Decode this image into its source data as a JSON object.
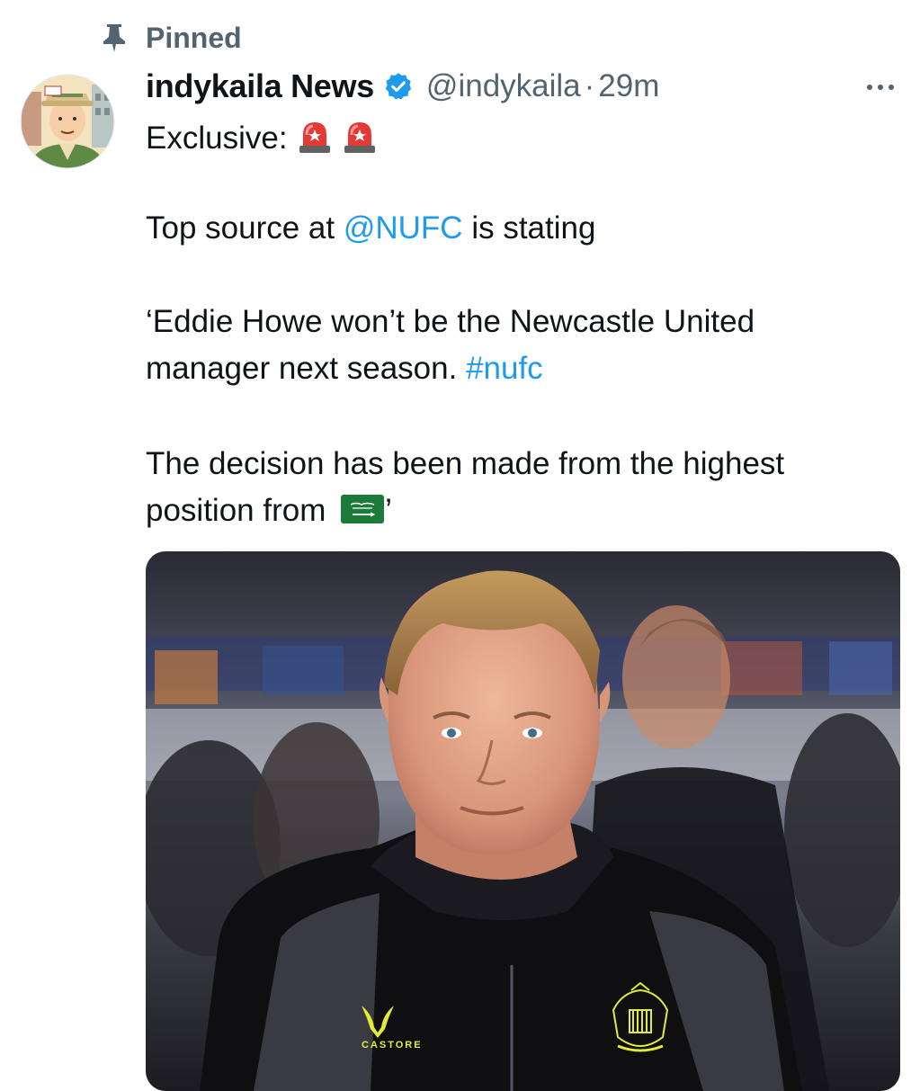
{
  "pinned": {
    "label": "Pinned"
  },
  "author": {
    "display_name": "indykaila News",
    "handle": "@indykaila",
    "separator": "·",
    "time": "29m"
  },
  "tweet": {
    "intro": "Exclusive:",
    "line_source_prefix": "Top source at ",
    "mention": "@NUFC",
    "line_source_suffix": " is stating",
    "quote_line1": "‘Eddie Howe won’t be the Newcastle United",
    "quote_line2_text": "manager next season. ",
    "hashtag": "#nufc",
    "decision_line1": "The decision has been made from the highest",
    "decision_line2_text": "position from ",
    "closing_quote": "’"
  },
  "media": {
    "kit_brand": "CASTORE"
  },
  "icons": {
    "pin": "pin-icon",
    "verified": "verified-badge-icon",
    "more": "more-options-icon",
    "siren": "police-siren-emoji",
    "flag": "saudi-arabia-flag-emoji"
  },
  "colors": {
    "link": "#1d9bf0",
    "secondary_text": "#536471",
    "primary_text": "#0f1419",
    "verified": "#1d9bf0"
  }
}
